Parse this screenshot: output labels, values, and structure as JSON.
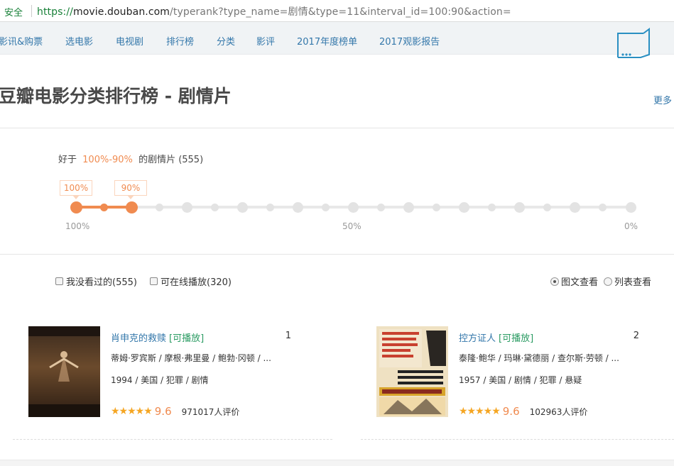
{
  "browser": {
    "secure_label": "安全",
    "url_scheme": "https://",
    "url_host": "movie.douban.com",
    "url_path": "/typerank?type_name=剧情&type=11&interval_id=100:90&action="
  },
  "nav": {
    "items": [
      "影讯&购票",
      "选电影",
      "电视剧",
      "排行榜",
      "分类",
      "影评",
      "2017年度榜单",
      "2017观影报告"
    ]
  },
  "page": {
    "title": "豆瓣电影分类排行榜 - 剧情片",
    "more_link": "更多"
  },
  "filter": {
    "prefix": "好于",
    "range": "100%-90%",
    "suffix": "的剧情片 (555)",
    "tag_high": "100%",
    "tag_low": "90%",
    "scale": {
      "left": "100%",
      "mid": "50%",
      "right": "0%"
    },
    "selected_from_percent": 100,
    "selected_to_percent": 90
  },
  "options": {
    "unseen": "我没看过的(555)",
    "playable": "可在线播放(320)",
    "view_picture": "图文查看",
    "view_list": "列表查看"
  },
  "movies": [
    {
      "title": "肖申克的救赎",
      "playable": "[可播放]",
      "rank": "1",
      "cast": "蒂姆·罗宾斯 / 摩根·弗里曼 / 鲍勃·冈顿 / ...",
      "meta": "1994 / 美国 / 犯罪 / 剧情",
      "stars": "★★★★★",
      "score": "9.6",
      "votes": "971017人评价"
    },
    {
      "title": "控方证人",
      "playable": "[可播放]",
      "rank": "2",
      "cast": "泰隆·鲍华 / 玛琳·黛德丽 / 查尔斯·劳顿 / ...",
      "meta": "1957 / 美国 / 剧情 / 犯罪 / 悬疑",
      "stars": "★★★★★",
      "score": "9.6",
      "votes": "102963人评价"
    }
  ],
  "colors": {
    "link": "#3377aa",
    "accent": "#f08b50",
    "green": "#2a9b62",
    "star": "#f5a623"
  }
}
